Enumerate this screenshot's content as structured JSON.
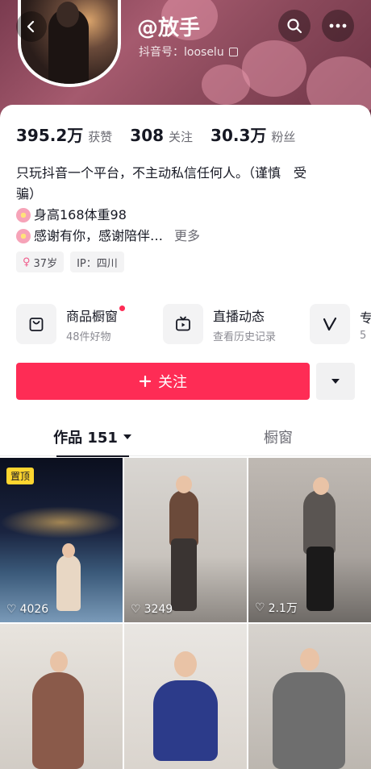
{
  "profile": {
    "nickname": "@放手",
    "douyin_id": "抖音号：looselu"
  },
  "stats": [
    {
      "value": "395.2万",
      "label": "获赞"
    },
    {
      "value": "308",
      "label": "关注"
    },
    {
      "value": "30.3万",
      "label": "粉丝"
    }
  ],
  "bio": {
    "line1": "只玩抖音一个平台，不主动私信任何人。（谨慎　受",
    "line2": "骗）",
    "line3": "身高168体重98",
    "line4": "感谢有你，感谢陪伴…",
    "more": "更多"
  },
  "tags": {
    "age": "37岁",
    "ip": "IP：四川"
  },
  "shortcuts": [
    {
      "title": "商品橱窗",
      "subtitle": "48件好物",
      "icon": "shopping-bag-icon"
    },
    {
      "title": "直播动态",
      "subtitle": "查看历史记录",
      "icon": "tv-icon"
    },
    {
      "title": "专",
      "subtitle": "5",
      "icon": "v-icon"
    }
  ],
  "actions": {
    "follow_label": "关注"
  },
  "tabs": {
    "works": "作品 151",
    "showcase": "橱窗"
  },
  "videos": [
    {
      "likes": "4026",
      "pinned": "置顶"
    },
    {
      "likes": "3249"
    },
    {
      "likes": "2.1万"
    },
    {
      "likes": ""
    },
    {
      "likes": ""
    },
    {
      "likes": ""
    }
  ],
  "colors": {
    "accent": "#fe2c55",
    "pinned_badge": "#fdd52f"
  }
}
